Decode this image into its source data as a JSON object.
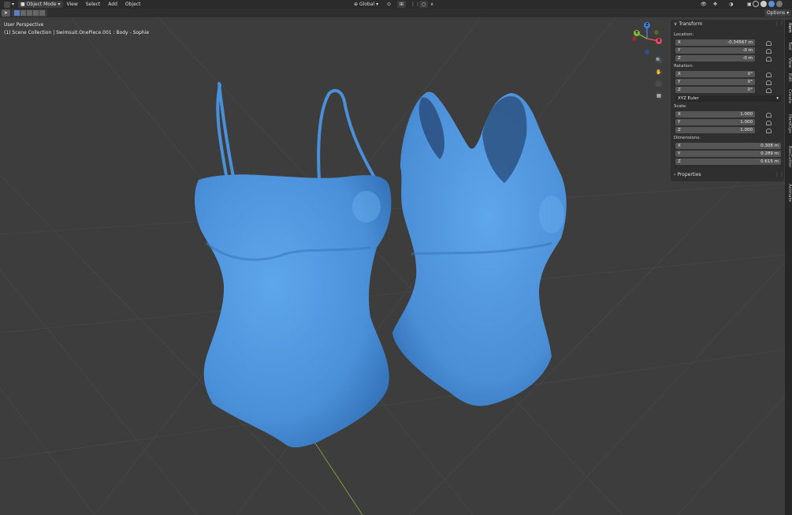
{
  "header": {
    "mode_label": "Object Mode",
    "menus": [
      "View",
      "Select",
      "Add",
      "Object"
    ],
    "transform_orientation": "Global",
    "options_label": "Options"
  },
  "viewport": {
    "perspective_label": "User Perspective",
    "collection_label": "(1) Scene Collection | Swimsuit.OnePiece.001 : Body - Sophie"
  },
  "gizmo": {
    "x": "X",
    "y": "Y",
    "z": "Z"
  },
  "npanel": {
    "title": "Transform",
    "location_label": "Location:",
    "location": [
      {
        "axis": "X",
        "value": "-0.34567 m"
      },
      {
        "axis": "Y",
        "value": "-0 m"
      },
      {
        "axis": "Z",
        "value": "-0 m"
      }
    ],
    "rotation_label": "Rotation:",
    "rotation": [
      {
        "axis": "X",
        "value": "0°"
      },
      {
        "axis": "Y",
        "value": "0°"
      },
      {
        "axis": "Z",
        "value": "0°"
      }
    ],
    "rotation_mode": "XYZ Euler",
    "scale_label": "Scale:",
    "scale": [
      {
        "axis": "X",
        "value": "1.000"
      },
      {
        "axis": "Y",
        "value": "1.000"
      },
      {
        "axis": "Z",
        "value": "1.000"
      }
    ],
    "dimensions_label": "Dimensions:",
    "dimensions": [
      {
        "axis": "X",
        "value": "0.308 m"
      },
      {
        "axis": "Y",
        "value": "0.289 m"
      },
      {
        "axis": "Z",
        "value": "0.615 m"
      }
    ],
    "properties_label": "Properties"
  },
  "side_tabs": [
    "Item",
    "Tool",
    "View",
    "Edit",
    "Create",
    "HardOps",
    "BoxCutter",
    "Animate"
  ],
  "colors": {
    "mesh": "#4a90d9",
    "viewport_bg": "#3d3d3d",
    "panel_bg": "#2f2f2f",
    "axis_x": "#e44d5e",
    "axis_y": "#7fb53a",
    "axis_z": "#3e7fdd"
  }
}
